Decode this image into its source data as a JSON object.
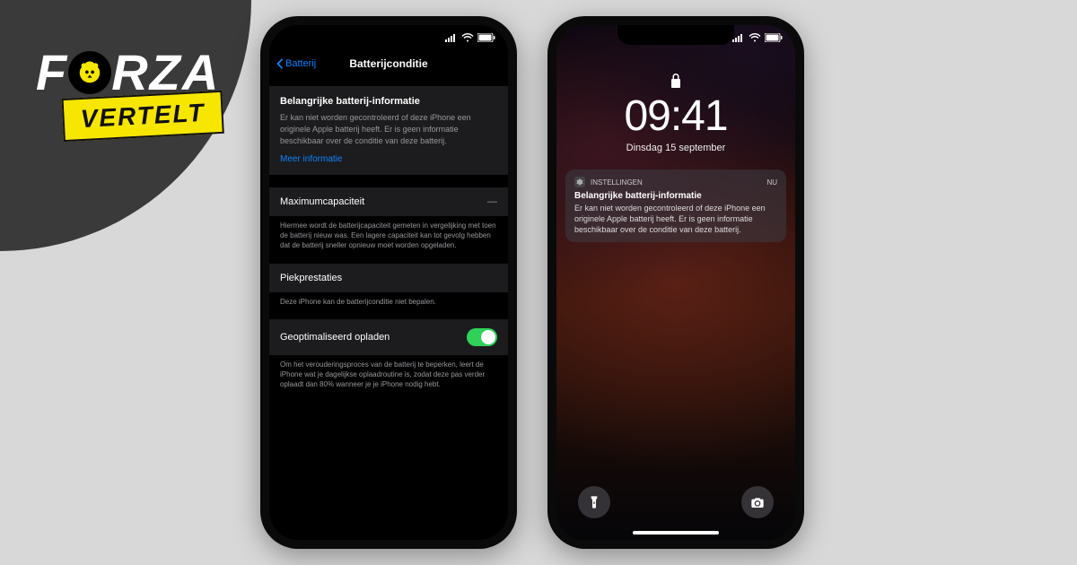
{
  "logo": {
    "brand_left": "F",
    "brand_right": "RZA",
    "badge": "VERTELT"
  },
  "left_phone": {
    "back_label": "Batterij",
    "title": "Batterijconditie",
    "important": {
      "title": "Belangrijke batterij-informatie",
      "body": "Er kan niet worden gecontroleerd of deze iPhone een originele Apple batterij heeft. Er is geen informatie beschikbaar over de conditie van deze batterij.",
      "link": "Meer informatie"
    },
    "capacity": {
      "label": "Maximumcapaciteit",
      "value": "—",
      "desc": "Hiermee wordt de batterijcapaciteit gemeten in vergelijking met toen de batterij nieuw was. Een lagere capaciteit kan tot gevolg hebben dat de batterij sneller opnieuw moet worden opgeladen."
    },
    "peak": {
      "label": "Piekprestaties",
      "desc": "Deze iPhone kan de batterijconditie niet bepalen."
    },
    "optimized": {
      "label": "Geoptimaliseerd opladen",
      "desc": "Om het verouderingsproces van de batterij te beperken, leert de iPhone wat je dagelijkse oplaadroutine is, zodat deze pas verder oplaadt dan 80% wanneer je je iPhone nodig hebt."
    }
  },
  "right_phone": {
    "time": "09:41",
    "date": "Dinsdag 15 september",
    "notification": {
      "app": "INSTELLINGEN",
      "timestamp": "nu",
      "title": "Belangrijke batterij-informatie",
      "body": "Er kan niet worden gecontroleerd of deze iPhone een originele Apple batterij heeft. Er is geen informatie beschikbaar over de conditie van deze batterij."
    }
  }
}
